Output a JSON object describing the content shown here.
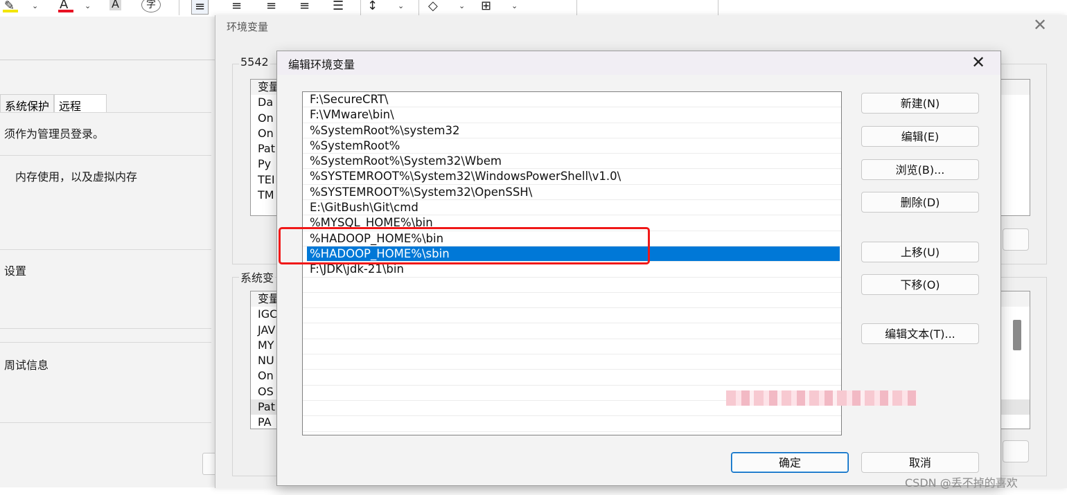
{
  "editor_ribbon": {
    "labels": [
      "A",
      "A",
      "字"
    ],
    "underline_colors": [
      "#f3e500",
      "#e81224"
    ]
  },
  "system_properties": {
    "tabs": [
      "系统保护",
      "远程"
    ],
    "admin_note": "须作为管理员登录。",
    "performance_text": "内存使用，以及虚拟内存",
    "user_profiles_label": "设置",
    "startup_recovery_label": "周试信息"
  },
  "env_dialog": {
    "title": "环境变量",
    "close_glyph": "✕",
    "user_section_label": "5542",
    "system_section_label": "系统变",
    "user_vars_clipped": [
      "变量",
      "Da",
      "On",
      "On",
      "Pat",
      "Py",
      "TEI",
      "TM"
    ],
    "system_vars_clipped": [
      "变量",
      "IGC",
      "JAV",
      "MY",
      "NU",
      "On",
      "OS",
      "Pat",
      "PA"
    ]
  },
  "edit_dialog": {
    "title": "编辑环境变量",
    "close_glyph": "✕",
    "entries": [
      "F:\\SecureCRT\\",
      "F:\\VMware\\bin\\",
      "%SystemRoot%\\system32",
      "%SystemRoot%",
      "%SystemRoot%\\System32\\Wbem",
      "%SYSTEMROOT%\\System32\\WindowsPowerShell\\v1.0\\",
      "%SYSTEMROOT%\\System32\\OpenSSH\\",
      "E:\\GitBush\\Git\\cmd",
      "%MYSQL_HOME%\\bin",
      "%HADOOP_HOME%\\bin",
      "%HADOOP_HOME%\\sbin",
      "F:\\JDK\\jdk-21\\bin"
    ],
    "selected_entry": "%HADOOP_HOME%\\sbin",
    "buttons": {
      "new": "新建(N)",
      "edit": "编辑(E)",
      "browse": "浏览(B)...",
      "delete": "删除(D)",
      "move_up": "上移(U)",
      "move_down": "下移(O)",
      "edit_text": "编辑文本(T)...",
      "ok": "确定",
      "cancel": "取消"
    }
  },
  "watermark": "CSDN @丢不掉的喜欢",
  "colors": {
    "selection": "#0078d7",
    "annotation_box": "#f01818",
    "dialog_bg": "#f3f3f3"
  }
}
